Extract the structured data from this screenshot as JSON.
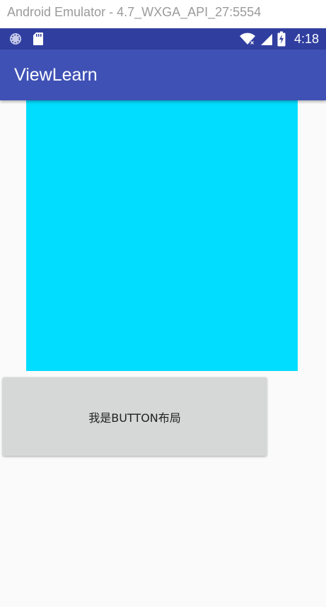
{
  "window": {
    "title": "Android Emulator - 4.7_WXGA_API_27:5554"
  },
  "status_bar": {
    "time": "4:18",
    "icons_left": [
      "sync-icon",
      "sd-card-icon"
    ],
    "icons_right": [
      "wifi-icon",
      "cell-signal-icon",
      "battery-charging-icon"
    ],
    "color": "#303f9f"
  },
  "app_bar": {
    "title": "ViewLearn",
    "color": "#3f51b5"
  },
  "main": {
    "cyan_view_color": "#00ddff",
    "button": {
      "label": "我是BUTTON布局",
      "color": "#d6d7d7"
    }
  }
}
